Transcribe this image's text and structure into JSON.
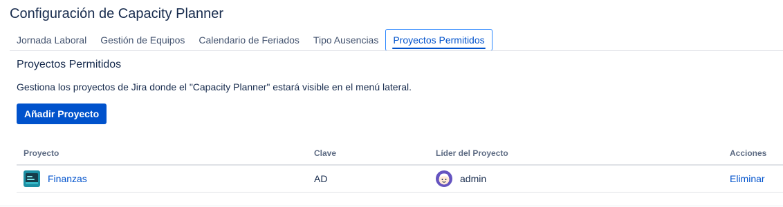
{
  "page": {
    "title": "Configuración de Capacity Planner"
  },
  "tabs": [
    {
      "label": "Jornada Laboral",
      "active": false
    },
    {
      "label": "Gestión de Equipos",
      "active": false
    },
    {
      "label": "Calendario de Feriados",
      "active": false
    },
    {
      "label": "Tipo Ausencias",
      "active": false
    },
    {
      "label": "Proyectos Permitidos",
      "active": true
    }
  ],
  "section": {
    "title": "Proyectos Permitidos",
    "description": "Gestiona los proyectos de Jira donde el \"Capacity Planner\" estará visible en el menú lateral.",
    "add_button": "Añadir Proyecto"
  },
  "table": {
    "headers": {
      "project": "Proyecto",
      "key": "Clave",
      "lead": "Líder del Proyecto",
      "actions": "Acciones"
    },
    "rows": [
      {
        "project": "Finanzas",
        "project_icon": "project-avatar-icon",
        "key": "AD",
        "lead": "admin",
        "lead_avatar": "user-avatar-icon",
        "action": "Eliminar"
      }
    ]
  },
  "colors": {
    "accent": "#0052cc",
    "text": "#172b4d",
    "muted": "#5e6c84",
    "border": "#dfe1e6"
  }
}
